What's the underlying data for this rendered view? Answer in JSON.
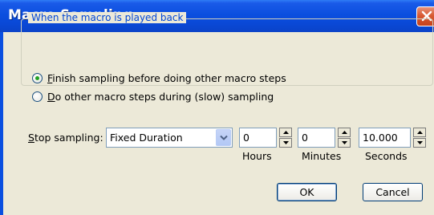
{
  "window": {
    "title": "Macro Sampling"
  },
  "group": {
    "legend": "When the macro is played back",
    "options": [
      {
        "text": "Finish sampling before doing other macro steps",
        "mnemonic": "F",
        "rest": "inish sampling before doing other macro steps",
        "checked": true
      },
      {
        "text": "Do other macro steps during (slow) sampling",
        "mnemonic": "D",
        "rest": "o other macro steps during (slow) sampling",
        "checked": false
      }
    ]
  },
  "stop": {
    "label_mnemonic": "S",
    "label_rest": "top sampling:",
    "mode": "Fixed Duration",
    "hours": "0",
    "minutes": "0",
    "seconds": "10.000",
    "hours_label": "Hours",
    "minutes_label": "Minutes",
    "seconds_label": "Seconds"
  },
  "buttons": {
    "ok": "OK",
    "cancel": "Cancel"
  }
}
